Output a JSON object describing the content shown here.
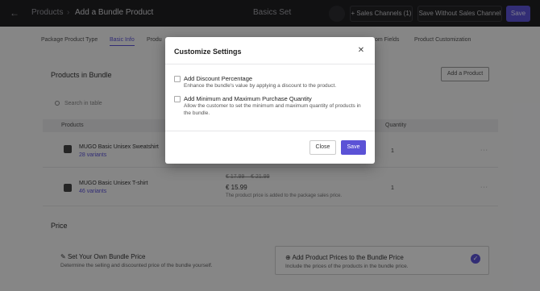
{
  "topbar": {
    "back_icon": "arrow-left-icon",
    "breadcrumb": "Products",
    "separator": "›",
    "title": "Add a Bundle Product",
    "set_name": "Basics Set",
    "sales_channels_label": "+ Sales Channels (1)",
    "save_without_label": "Save Without Sales Channel",
    "save_label": "Save"
  },
  "tabs": [
    {
      "label": "Package Product Type"
    },
    {
      "label": "Basic Info"
    },
    {
      "label": "Produ"
    },
    {
      "label": "om Fields"
    },
    {
      "label": "Product Customization"
    }
  ],
  "products_section": {
    "title": "Products in Bundle",
    "add_product_label": "Add a Product",
    "search_placeholder": "Search in table",
    "col_products": "Products",
    "col_quantity": "Quantity",
    "rows": [
      {
        "name": "MUGO Basic Unisex Sweatshirt",
        "variants": "28 variants",
        "qty": "1",
        "icon": "sweatshirt-icon"
      },
      {
        "name": "MUGO Basic Unisex T-shirt",
        "variants": "46 variants",
        "qty": "1",
        "icon": "tshirt-icon",
        "price_old": "€ 17.99 – € 21.99",
        "price_new": "€ 15.99",
        "price_note": "The product price is added to the package sales price."
      }
    ]
  },
  "price_section": {
    "title": "Price",
    "own_price_title": "Set Your Own Bundle Price",
    "own_price_desc": "Determine the selling and discounted price of the bundle yourself.",
    "add_prices_title": "Add Product Prices to the Bundle Price",
    "add_prices_desc": "Include the prices of the products in the bundle price."
  },
  "modal": {
    "title": "Customize Settings",
    "close_icon": "close-icon",
    "options": [
      {
        "label": "Add Discount Percentage",
        "desc": "Enhance the bundle's value by applying a discount to the product.",
        "checked": false
      },
      {
        "label": "Add Minimum and Maximum Purchase Quantity",
        "desc": "Allow the customer to set the minimum and maximum quantity of products in the bundle.",
        "checked": false
      }
    ],
    "close_label": "Close",
    "save_label": "Save"
  },
  "colors": {
    "accent": "#5b52d6",
    "topbar_bg": "#1f1f22",
    "overlay": "rgba(0,0,0,0.45)"
  }
}
